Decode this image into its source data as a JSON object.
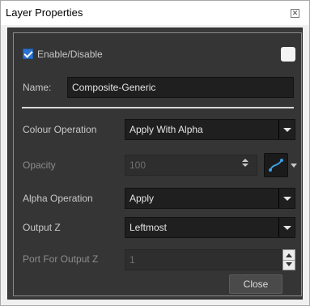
{
  "window": {
    "title": "Layer Properties",
    "close_glyph": "✕"
  },
  "enable": {
    "label": "Enable/Disable",
    "checked": true
  },
  "name": {
    "label": "Name:",
    "value": "Composite-Generic"
  },
  "colour_operation": {
    "label": "Colour Operation",
    "value": "Apply With Alpha"
  },
  "opacity": {
    "label": "Opacity",
    "value": "100",
    "function_icon": "bezier-curve-icon"
  },
  "alpha_operation": {
    "label": "Alpha Operation",
    "value": "Apply"
  },
  "output_z": {
    "label": "Output Z",
    "value": "Leftmost"
  },
  "port_output_z": {
    "label": "Port For Output Z",
    "value": "1"
  },
  "buttons": {
    "close_label": "Close"
  },
  "colors": {
    "panel_bg": "#353535",
    "field_bg": "#1f1f1f",
    "accent_check": "#2a73d0",
    "function_icon": "#3aa0e0"
  }
}
